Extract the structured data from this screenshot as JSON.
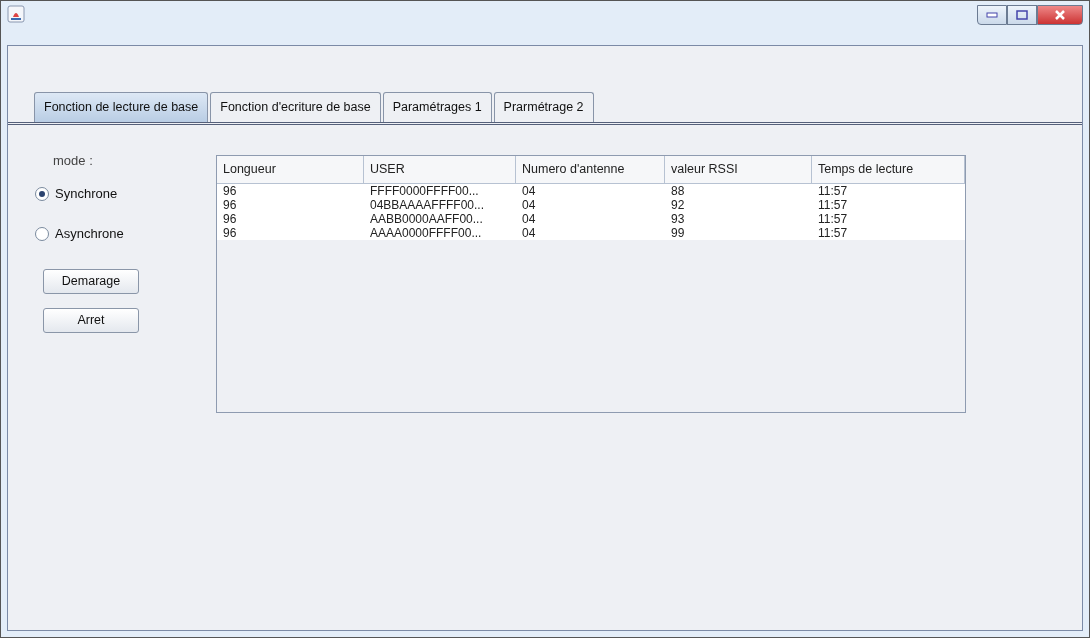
{
  "tabs": [
    {
      "label": "Fonction de lecture de base",
      "selected": true
    },
    {
      "label": "Fonction d'ecriture de base",
      "selected": false
    },
    {
      "label": "Paramétrages 1",
      "selected": false
    },
    {
      "label": "Prarmétrage 2",
      "selected": false
    }
  ],
  "mode": {
    "label": "mode :",
    "options": [
      {
        "label": "Synchrone",
        "selected": true
      },
      {
        "label": "Asynchrone",
        "selected": false
      }
    ]
  },
  "buttons": [
    "Demarage",
    "Arret"
  ],
  "table": {
    "columns": [
      "Longueur",
      "USER",
      "Numero d'antenne",
      "valeur RSSI",
      "Temps de lecture"
    ],
    "rows": [
      [
        "96",
        "FFFF0000FFFF00...",
        "04",
        "88",
        "11:57"
      ],
      [
        "96",
        "04BBAAAAFFFF00...",
        "04",
        "92",
        "11:57"
      ],
      [
        "96",
        "AABB0000AAFF00...",
        "04",
        "93",
        "11:57"
      ],
      [
        "96",
        "AAAA0000FFFF00...",
        "04",
        "99",
        "11:57"
      ]
    ]
  }
}
